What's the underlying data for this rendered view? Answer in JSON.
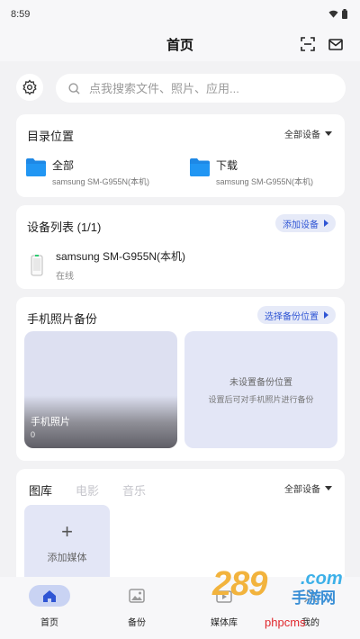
{
  "status_bar": {
    "time": "8:59"
  },
  "header": {
    "title": "首页"
  },
  "search": {
    "placeholder": "点我搜索文件、照片、应用..."
  },
  "directory": {
    "title": "目录位置",
    "device_select": "全部设备",
    "folders": [
      {
        "name": "全部",
        "device": "samsung SM-G955N(本机)"
      },
      {
        "name": "下载",
        "device": "samsung SM-G955N(本机)"
      }
    ]
  },
  "devices": {
    "title": "设备列表 (1/1)",
    "add_button": "添加设备",
    "items": [
      {
        "name": "samsung SM-G955N(本机)",
        "status": "在线"
      }
    ]
  },
  "backup": {
    "title": "手机照片备份",
    "choose_button": "选择备份位置",
    "photo_tile": {
      "label": "手机照片",
      "count": "0"
    },
    "empty_tile": {
      "title": "未设置备份位置",
      "subtitle": "设置后可对手机照片进行备份"
    }
  },
  "gallery": {
    "tabs": [
      "图库",
      "电影",
      "音乐"
    ],
    "device_select": "全部设备",
    "add_media": "添加媒体"
  },
  "bottom_nav": {
    "items": [
      {
        "label": "首页",
        "icon": "home-icon"
      },
      {
        "label": "备份",
        "icon": "image-icon"
      },
      {
        "label": "媒体库",
        "icon": "media-library-icon"
      },
      {
        "label": "我的",
        "icon": "profile-icon"
      }
    ]
  },
  "watermark": {
    "logo": "289",
    "com": ".com",
    "site": "手游网",
    "text": "phpcms"
  },
  "colors": {
    "accent": "#2f55d4",
    "folder": "#1e88e5",
    "pill_bg": "#e6eaf8",
    "tile_bg": "#e3e6f6",
    "nav_active_bg": "#c9d3f3"
  }
}
